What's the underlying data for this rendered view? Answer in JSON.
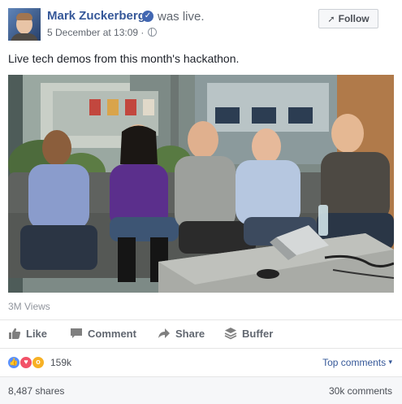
{
  "post": {
    "author": "Mark Zuckerberg",
    "status": "was live.",
    "date": "5 December at 13:09 ·",
    "follow_label": "Follow",
    "text": "Live tech demos from this month's hackathon.",
    "views": "3M Views"
  },
  "actions": {
    "like": "Like",
    "comment": "Comment",
    "share": "Share",
    "buffer": "Buffer"
  },
  "reactions": {
    "types": [
      "like-icon",
      "love-icon",
      "wow-icon"
    ],
    "count": "159k",
    "top_comments": "Top comments"
  },
  "footer": {
    "shares": "8,487 shares",
    "comments": "30k comments"
  },
  "colors": {
    "link": "#365899",
    "like": "#5890ff",
    "love": "#f25268",
    "wow": "#f7b125"
  }
}
